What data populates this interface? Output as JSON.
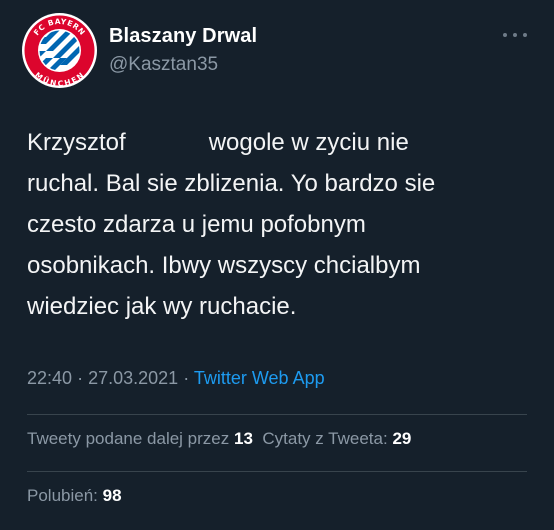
{
  "author": {
    "display_name": "Blaszany Drwal",
    "handle": "@Kasztan35",
    "avatar": {
      "icon": "fc-bayern-munchen-logo",
      "ring_text_top": "FC BAYERN",
      "ring_text_bottom": "MÜNCHEN",
      "colors": {
        "ring": "#dc052d",
        "blue": "#0066b2",
        "white": "#ffffff"
      }
    }
  },
  "more_icon": "more-horizontal-icon",
  "tweet": {
    "lines": [
      {
        "before": "Krzysztof",
        "after": "wogole w zyciu nie"
      },
      "ruchal. Bal sie zblizenia. Yo bardzo sie",
      "czesto zdarza u jemu pofobnym",
      "osobnikach. Ibwy wszyscy chcialbym",
      "wiedziec jak wy ruchacie."
    ]
  },
  "meta": {
    "time": "22:40",
    "separator": "·",
    "date": "27.03.2021",
    "source": "Twitter Web App"
  },
  "stats": {
    "retweets_label": "Tweety podane dalej przez",
    "retweets_count": "13",
    "quotes_label": "Cytaty z Tweeta:",
    "quotes_count": "29",
    "likes_label": "Polubień:",
    "likes_count": "98"
  },
  "colors": {
    "background": "#15202b",
    "secondary_text": "#8b98a5",
    "link": "#1d9bf0",
    "divider": "#38444d"
  }
}
